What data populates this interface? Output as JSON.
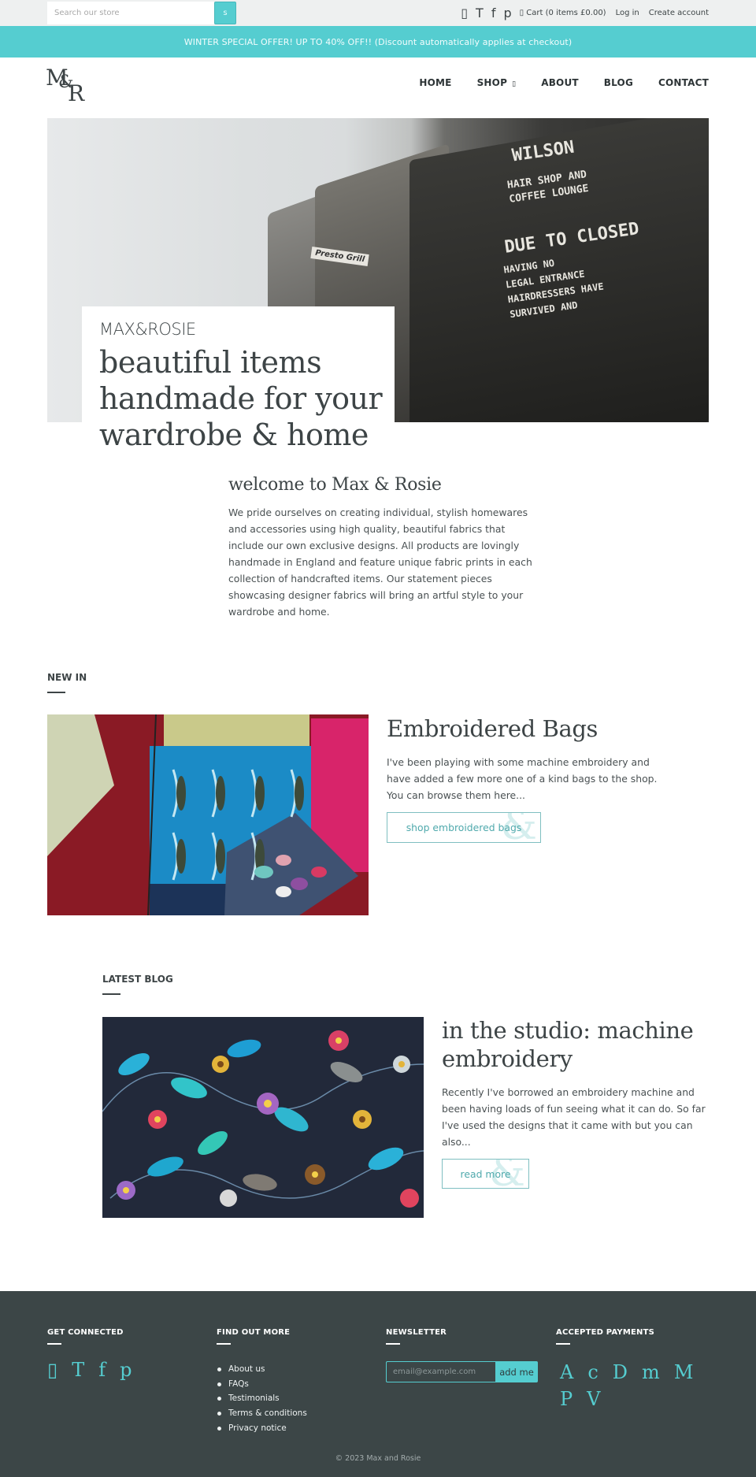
{
  "topbar": {
    "search_placeholder": "Search our store",
    "search_button": "s",
    "social_icons": [
      {
        "name": "instagram-icon",
        "glyph": "▯"
      },
      {
        "name": "twitter-icon",
        "glyph": "T"
      },
      {
        "name": "facebook-icon",
        "glyph": "f"
      },
      {
        "name": "pinterest-icon",
        "glyph": "p"
      }
    ],
    "cart_label": "▯ Cart (0 items £0.00)",
    "login_label": "Log in",
    "create_account_label": "Create account"
  },
  "announcement": "WINTER SPECIAL OFFER! UP TO 40% OFF!! (Discount automatically applies at checkout)",
  "header": {
    "logo": {
      "m": "M",
      "amp": "&",
      "r": "R"
    },
    "nav": [
      {
        "label": "HOME"
      },
      {
        "label": "SHOP",
        "caret": "▯"
      },
      {
        "label": "ABOUT"
      },
      {
        "label": "BLOG"
      },
      {
        "label": "CONTACT"
      }
    ]
  },
  "hero": {
    "brand": "MAX&ROSIE",
    "title": "beautiful items handmade for your wardrobe & home",
    "image_text": {
      "sign1": "WILSON",
      "sign2": "HAIR SHOP AND\nCOFFEE LOUNGE",
      "sign3": "DUE TO CLOSED",
      "sign4": "HAVING NO\nLEGAL ENTRANCE\nHAIRDRESSERS HAVE\nSURVIVED AND",
      "presto": "Presto Grill"
    }
  },
  "welcome": {
    "title": "welcome to Max & Rosie",
    "body": "We pride ourselves on creating individual, stylish homewares and accessories using high quality, beautiful fabrics that include our own exclusive designs. All products are lovingly handmade in England and feature unique fabric prints in each collection of handcrafted items. Our statement pieces showcasing designer fabrics will bring an artful style to your wardrobe and home."
  },
  "new_in": {
    "heading": "NEW IN",
    "title": "Embroidered Bags",
    "body": "I've been playing with some machine embroidery and have added a few more one of a kind bags to the shop. You can browse them here...",
    "button": "shop embroidered bags"
  },
  "latest_blog": {
    "heading": "LATEST BLOG",
    "title": "in the studio: machine embroidery",
    "body": "Recently I've borrowed an embroidery machine and been having loads of fun seeing what it can do. So far I've used the designs that it came with but you can also...",
    "button": "read more"
  },
  "footer": {
    "get_connected": {
      "heading": "GET CONNECTED",
      "icons": [
        {
          "name": "instagram-icon",
          "glyph": "▯"
        },
        {
          "name": "twitter-icon",
          "glyph": "T"
        },
        {
          "name": "facebook-icon",
          "glyph": "f"
        },
        {
          "name": "pinterest-icon",
          "glyph": "p"
        }
      ]
    },
    "find_out_more": {
      "heading": "FIND OUT MORE",
      "links": [
        "About us",
        "FAQs",
        "Testimonials",
        "Terms & conditions",
        "Privacy notice"
      ]
    },
    "newsletter": {
      "heading": "NEWSLETTER",
      "placeholder": "email@example.com",
      "button": "add me"
    },
    "payments": {
      "heading": "ACCEPTED PAYMENTS",
      "icons": [
        {
          "name": "amex-icon",
          "glyph": "A"
        },
        {
          "name": "cirrus-icon",
          "glyph": "c"
        },
        {
          "name": "diners-icon",
          "glyph": "D"
        },
        {
          "name": "maestro-icon",
          "glyph": "m"
        },
        {
          "name": "mastercard-icon",
          "glyph": "M"
        },
        {
          "name": "paypal-icon",
          "glyph": "P"
        },
        {
          "name": "visa-icon",
          "glyph": "V"
        }
      ]
    },
    "copyright": "© 2023 Max and Rosie"
  },
  "colors": {
    "accent": "#55cdd0",
    "text": "#3d4446",
    "footer_bg": "#3c4647",
    "topbar_bg": "#eef0f0"
  }
}
